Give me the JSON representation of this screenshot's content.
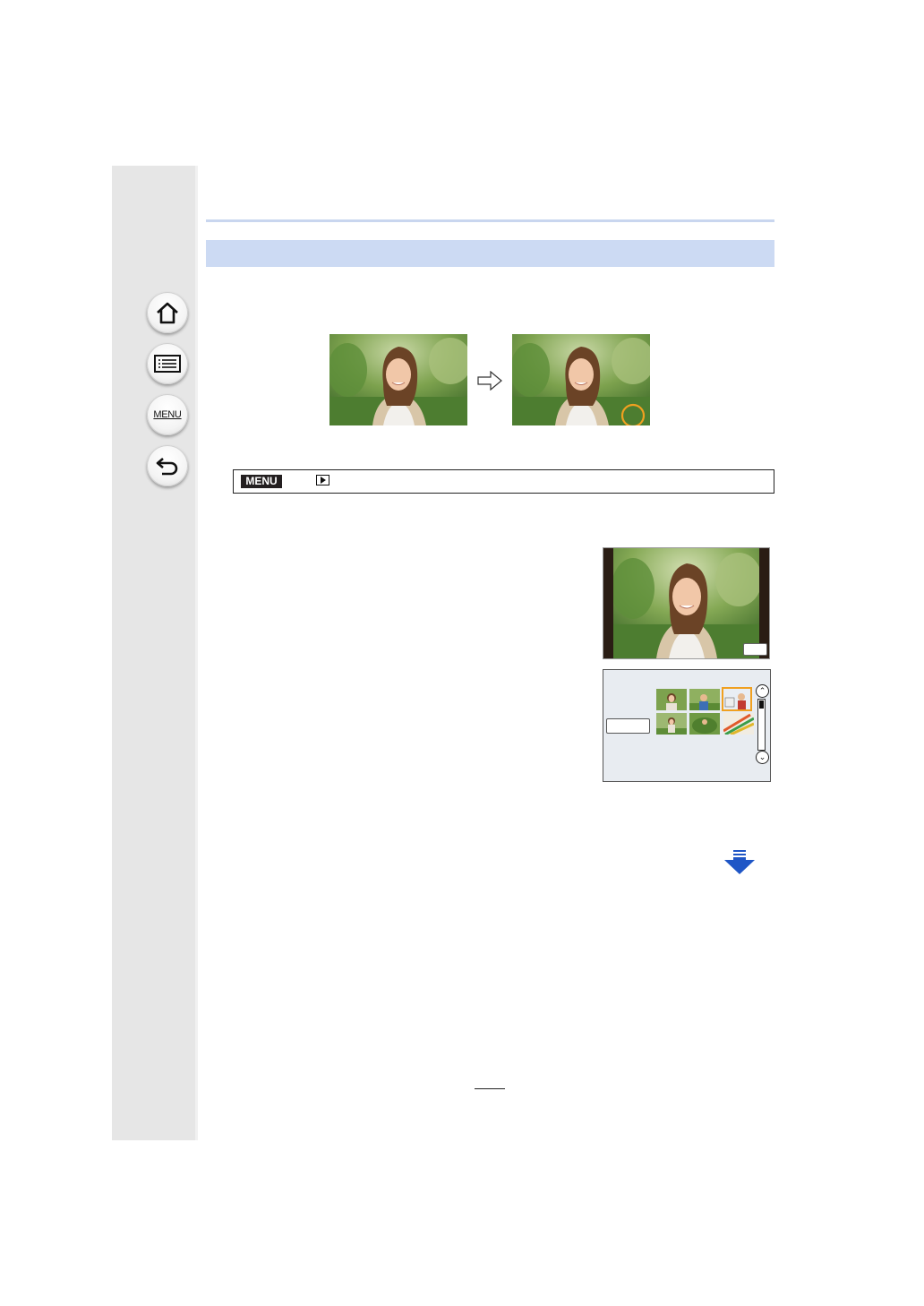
{
  "sidebar": {
    "items": [
      {
        "icon": "home-icon"
      },
      {
        "icon": "contents-list-icon"
      },
      {
        "icon": "menu-icon",
        "label": "MENU"
      },
      {
        "icon": "back-arrow-icon"
      }
    ]
  },
  "menu_path": {
    "badge": "MENU",
    "mode_icon": "playback-icon"
  },
  "colors": {
    "section_bar": "#ccdaf3",
    "top_rule": "#c9d6ef",
    "sidebar": "#e6e6e6",
    "highlight_circle": "#f0a020",
    "next_arrow": "#1f56c6"
  },
  "icons": {
    "comparison_arrow": "right-arrow-icon",
    "continued": "down-arrow-icon"
  }
}
